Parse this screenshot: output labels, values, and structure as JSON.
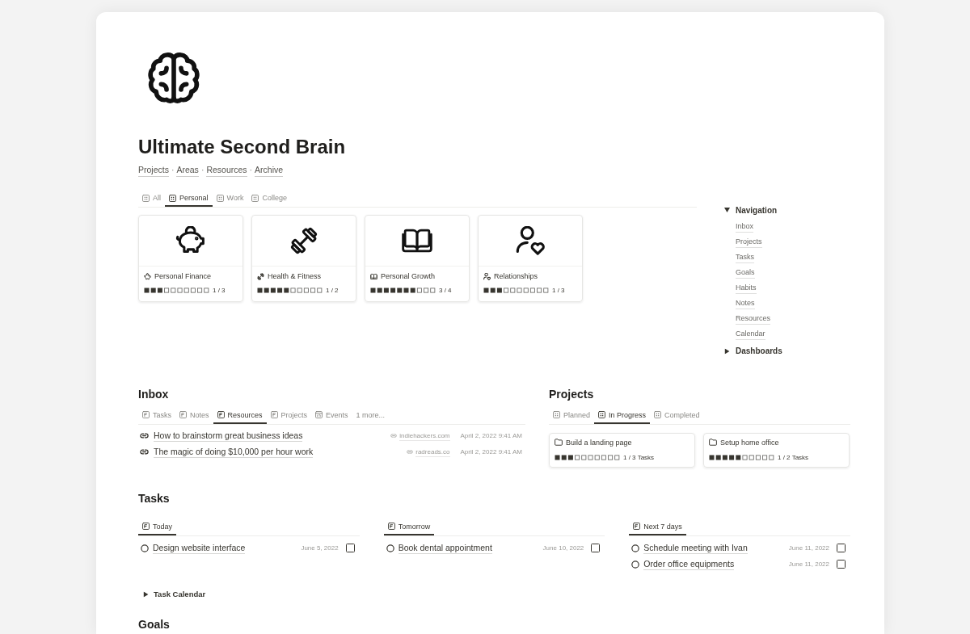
{
  "page": {
    "title": "Ultimate Second Brain",
    "links": [
      {
        "kind": "link",
        "text": "Projects"
      },
      {
        "kind": "separator",
        "text": "·"
      },
      {
        "kind": "link",
        "text": "Areas"
      },
      {
        "kind": "separator",
        "text": "·"
      },
      {
        "kind": "link",
        "text": "Resources"
      },
      {
        "kind": "separator",
        "text": "·"
      },
      {
        "kind": "link",
        "text": "Archive"
      }
    ]
  },
  "area_tabs": [
    {
      "label": "All",
      "selected": false
    },
    {
      "label": "Personal",
      "selected": true
    },
    {
      "label": "Work",
      "selected": false
    },
    {
      "label": "College",
      "selected": false
    }
  ],
  "area_cards": [
    {
      "title": "Personal Finance",
      "level": 0.3,
      "reading": "1 / 3"
    },
    {
      "title": "Health & Fitness",
      "level": 0.5,
      "reading": "1 / 2"
    },
    {
      "title": "Personal Growth",
      "level": 0.7,
      "reading": "3 / 4"
    },
    {
      "title": "Relationships",
      "level": 0.3,
      "reading": "1 / 3"
    }
  ],
  "sidebar": [
    {
      "title": "Navigation",
      "expanded": true,
      "items": [
        "Inbox",
        "Projects",
        "Tasks",
        "Goals",
        "Habits",
        "Notes",
        "Resources",
        "Calendar"
      ]
    },
    {
      "title": "Dashboards",
      "expanded": false
    }
  ],
  "inbox": {
    "title": "Inbox",
    "tabs": [
      {
        "label": "Tasks",
        "kind": "list",
        "selected": false
      },
      {
        "label": "Notes",
        "kind": "list",
        "selected": false
      },
      {
        "label": "Resources",
        "kind": "list",
        "selected": true
      },
      {
        "label": "Projects",
        "kind": "list",
        "selected": false
      },
      {
        "label": "Events",
        "kind": "calendar",
        "selected": false
      },
      {
        "label": "1 more...",
        "kind": "more",
        "selected": false
      }
    ],
    "rows": [
      {
        "title": "How to brainstorm great business ideas",
        "source": "indiehackers.com",
        "date": "April 2, 2022 9:41 AM"
      },
      {
        "title": "The magic of doing $10,000 per hour work",
        "source": "radreads.co",
        "date": "April 2, 2022 9:41 AM"
      }
    ]
  },
  "projects": {
    "title": "Projects",
    "tabs": [
      {
        "label": "Planned",
        "selected": false
      },
      {
        "label": "In Progress",
        "selected": true
      },
      {
        "label": "Completed",
        "selected": false
      }
    ],
    "cards": [
      {
        "title": "Build a landing page",
        "level": 0.3,
        "reading": "1 / 3 Tasks"
      },
      {
        "title": "Setup home office",
        "level": 0.5,
        "reading": "1 / 2 Tasks"
      }
    ]
  },
  "tasks": {
    "title": "Tasks",
    "columns": [
      {
        "tab": {
          "label": "Today",
          "selected": true
        },
        "items": [
          {
            "title": "Design website interface",
            "date": "June 5, 2022",
            "checked": false
          }
        ]
      },
      {
        "tab": {
          "label": "Tomorrow",
          "selected": true
        },
        "items": [
          {
            "title": "Book dental appointment",
            "date": "June 10, 2022",
            "checked": false
          }
        ]
      },
      {
        "tab": {
          "label": "Next 7 days",
          "selected": true
        },
        "items": [
          {
            "title": "Schedule meeting with Ivan",
            "date": "June 11, 2022",
            "checked": false
          },
          {
            "title": "Order office equipments",
            "date": "June 11, 2022",
            "checked": false
          }
        ]
      }
    ],
    "calendar_toggle": {
      "title": "Task Calendar",
      "expanded": false
    }
  },
  "goals": {
    "title": "Goals"
  }
}
